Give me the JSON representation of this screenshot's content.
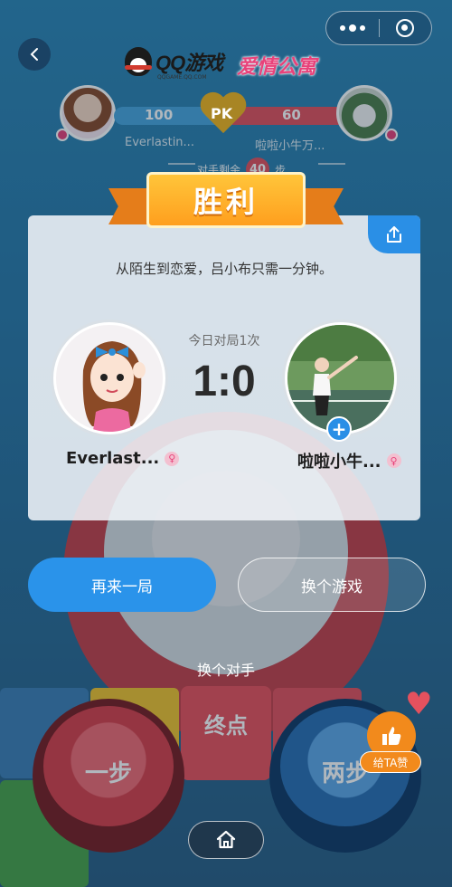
{
  "header": {
    "more_icon": "more-dots-icon",
    "close_icon": "target-circle-icon",
    "back_icon": "chevron-left-icon",
    "logo_qq": "QQ游戏",
    "logo_qq_sub": "QQGAME.QQ.COM",
    "logo_love": "爱情公寓"
  },
  "pk": {
    "left_score": "100",
    "right_score": "60",
    "label": "PK",
    "left_name": "Everlastin...",
    "right_name": "啦啦小牛万...",
    "steps_label": "对手剩余",
    "steps_value": "40",
    "steps_unit": "步"
  },
  "result": {
    "banner": "胜利",
    "slogan": "从陌生到恋爱，吕小布只需一分钟。",
    "today_label": "今日对局1次",
    "score": "1:0",
    "player_left_name": "Everlast...",
    "player_right_name": "啦啦小牛...",
    "gender_symbol": "♀",
    "add_symbol": "+",
    "share_icon": "share-icon"
  },
  "actions": {
    "play_again": "再来一局",
    "change_game": "换个游戏",
    "change_opponent": "换个对手",
    "like": "给TA赞",
    "home_icon": "home-icon"
  },
  "board": {
    "left_button": "一步",
    "end_tile": "终点",
    "right_button": "两步"
  },
  "colors": {
    "accent_blue": "#2a93ea",
    "win_orange": "#ff9f1e",
    "pk_red": "#e4515e",
    "pk_blue": "#4aa6dd"
  }
}
